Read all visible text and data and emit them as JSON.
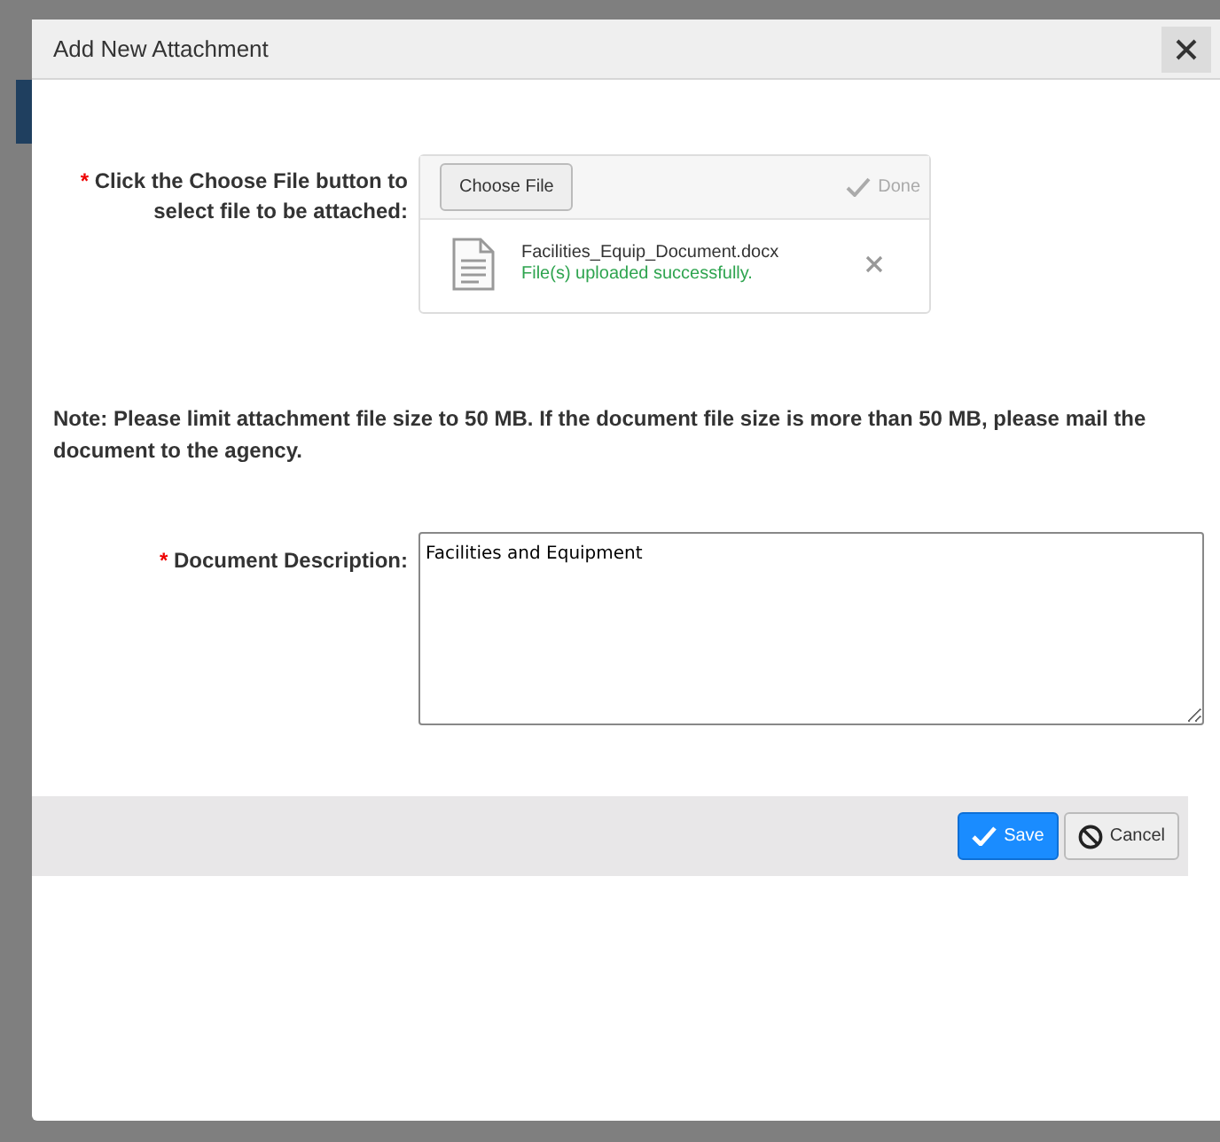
{
  "dialog": {
    "title": "Add New Attachment"
  },
  "upload": {
    "required_mark": "*",
    "label": "Click the Choose File button to select file to be attached:",
    "choose_button": "Choose File",
    "done": {
      "label": "Done",
      "disabled": true
    },
    "file": {
      "name": "Facilities_Equip_Document.docx",
      "message": "File(s) uploaded successfully."
    }
  },
  "note": "Note: Please limit attachment file size to 50 MB. If the document file size is more than 50 MB, please mail the document to the agency.",
  "description": {
    "required_mark": "*",
    "label": "Document Description:",
    "value": "Facilities and Equipment"
  },
  "buttons": [
    {
      "label": "Save",
      "kind": "primary"
    },
    {
      "label": "Cancel",
      "kind": "cancel"
    }
  ]
}
